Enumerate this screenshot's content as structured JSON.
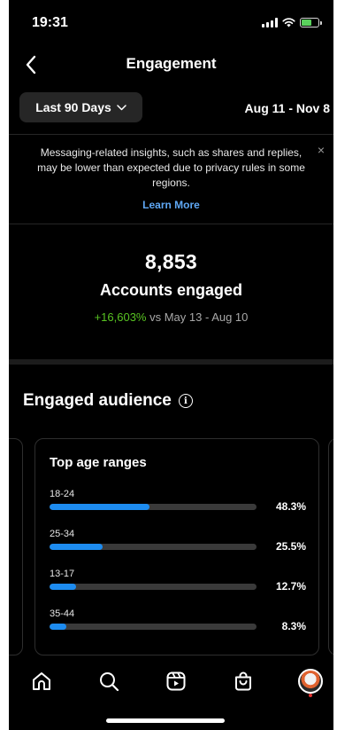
{
  "status_bar": {
    "time": "19:31"
  },
  "header": {
    "title": "Engagement"
  },
  "date_range": {
    "selector_label": "Last 90 Days",
    "dates": "Aug 11 - Nov 8"
  },
  "notice": {
    "text": "Messaging-related insights, such as shares and replies, may be lower than expected due to privacy rules in some regions.",
    "link": "Learn More",
    "close": "×"
  },
  "summary": {
    "value": "8,853",
    "label": "Accounts engaged",
    "change": "+16,603%",
    "compare": " vs May 13 - Aug 10"
  },
  "audience": {
    "title": "Engaged audience",
    "info_symbol": "i",
    "card_title": "Top age ranges",
    "age_ranges": [
      {
        "label": "18-24",
        "percent_text": "48.3%",
        "percent": 48.3
      },
      {
        "label": "25-34",
        "percent_text": "25.5%",
        "percent": 25.5
      },
      {
        "label": "13-17",
        "percent_text": "12.7%",
        "percent": 12.7
      },
      {
        "label": "35-44",
        "percent_text": "8.3%",
        "percent": 8.3
      }
    ]
  },
  "colors": {
    "accent_blue": "#1d8cf0",
    "positive_green": "#58c322",
    "link_blue": "#5fa8f5",
    "background": "#000000"
  },
  "nav": {
    "items": [
      "home-icon",
      "search-icon",
      "reels-icon",
      "shop-icon",
      "profile-avatar"
    ]
  }
}
